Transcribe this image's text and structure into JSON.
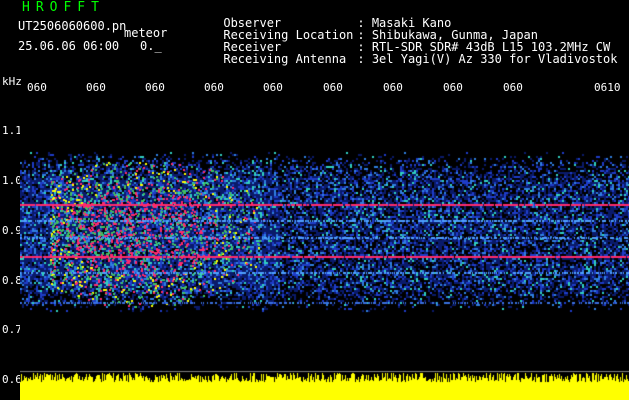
{
  "app": {
    "title": "HROFFT",
    "file_name": "UT2506060600.pn",
    "tag": "meteor",
    "date_time": "25.06.06 06:00",
    "level_indicator": "0._"
  },
  "info": [
    {
      "label": "Observer",
      "value": "Masaki Kano"
    },
    {
      "label": "Receiving Location",
      "value": "Shibukawa, Gunma, Japan"
    },
    {
      "label": "Receiver",
      "value": "RTL-SDR SDR# 43dB L15 103.2MHz CW"
    },
    {
      "label": "Receiving Antenna",
      "value": "3el Yagi(V) Az 330 for Vladivostok"
    }
  ],
  "separator": ":",
  "axis": {
    "unit": "kHz",
    "x_ticks": [
      "060",
      "060",
      "060",
      "060",
      "060",
      "060",
      "060",
      "060",
      "060",
      "0610"
    ],
    "y_ticks": [
      "1.1",
      "1.0",
      "0.9",
      "0.8",
      "0.7",
      "0.6"
    ]
  },
  "colors": {
    "title": "#00ff00",
    "text": "#ffffff",
    "background": "#000000",
    "strong_echo": "#ff2a6d",
    "medium_echo": "#ffff00",
    "noise": "#1e3cc8",
    "baseline": "#ffff00"
  }
}
